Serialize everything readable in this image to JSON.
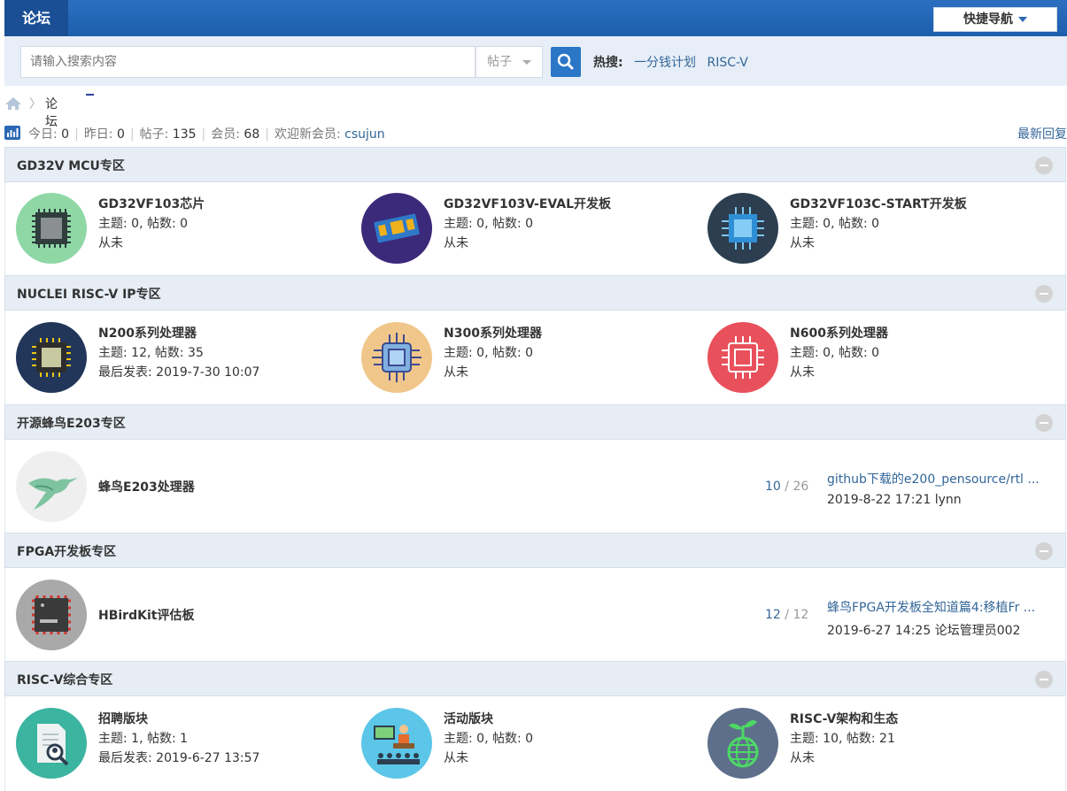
{
  "header": {
    "tab_label": "论坛",
    "quicknav_label": "快捷导航"
  },
  "search": {
    "placeholder": "请输入搜索内容",
    "type_label": "帖子",
    "hot_label": "热搜:",
    "hot_links": [
      "一分钱计划",
      "RISC-V"
    ]
  },
  "breadcrumb": {
    "separator": "〉",
    "current": "论坛"
  },
  "stats": {
    "today_label": "今日:",
    "today": "0",
    "yesterday_label": "昨日:",
    "yesterday": "0",
    "posts_label": "帖子:",
    "posts": "135",
    "members_label": "会员:",
    "members": "68",
    "newmember_label": "欢迎新会员:",
    "newmember": "csujun",
    "latest_link": "最新回复"
  },
  "sections": [
    {
      "title": "GD32V MCU专区",
      "forums": [
        {
          "name": "GD32VF103芯片",
          "l2": "主题: 0, 帖数: 0",
          "l3": "从未",
          "icon": "chip-icon"
        },
        {
          "name": "GD32VF103V-EVAL开发板",
          "l2": "主题: 0, 帖数: 0",
          "l3": "从未",
          "icon": "dev-board-icon"
        },
        {
          "name": "GD32VF103C-START开发板",
          "l2": "主题: 0, 帖数: 0",
          "l3": "从未",
          "icon": "cpu-icon"
        }
      ]
    },
    {
      "title": "NUCLEI RISC-V IP专区",
      "forums": [
        {
          "name": "N200系列处理器",
          "l2": "主题: 12, 帖数: 35",
          "l3": "最后发表: 2019-7-30 10:07",
          "icon": "processor-icon"
        },
        {
          "name": "N300系列处理器",
          "l2": "主题: 0, 帖数: 0",
          "l3": "从未",
          "icon": "circuit-chip-icon"
        },
        {
          "name": "N600系列处理器",
          "l2": "主题: 0, 帖数: 0",
          "l3": "从未",
          "icon": "outline-chip-icon"
        }
      ]
    },
    {
      "title": "开源蜂鸟E203专区",
      "forums": [
        {
          "name": "蜂鸟E203处理器",
          "topics": "10",
          "posts": "26",
          "last_title": "github下载的e200_pensource/rtl ...",
          "last_meta": "2019-8-22 17:21 lynn",
          "icon": "hummingbird-icon"
        }
      ]
    },
    {
      "title": "FPGA开发板专区",
      "forums": [
        {
          "name": "HBirdKit评估板",
          "topics": "12",
          "posts": "12",
          "last_title": "蜂鸟FPGA开发板全知道篇4:移植Fr ...",
          "last_meta": "2019-6-27 14:25 论坛管理员002",
          "icon": "fpga-board-icon"
        }
      ]
    },
    {
      "title": "RISC-V综合专区",
      "forums": [
        {
          "name": "招聘版块",
          "l2": "主题: 1, 帖数: 1",
          "l3": "最后发表: 2019-6-27 13:57",
          "icon": "resume-search-icon"
        },
        {
          "name": "活动版块",
          "l2": "主题: 0, 帖数: 0",
          "l3": "从未",
          "icon": "presentation-icon"
        },
        {
          "name": "RISC-V架构和生态",
          "l2": "主题: 10, 帖数: 21",
          "l3": "从未",
          "icon": "globe-sprout-icon"
        }
      ]
    }
  ],
  "colors": {
    "header_blue": "#1d5fae",
    "link": "#336699",
    "section_bg": "#e6edf5"
  }
}
